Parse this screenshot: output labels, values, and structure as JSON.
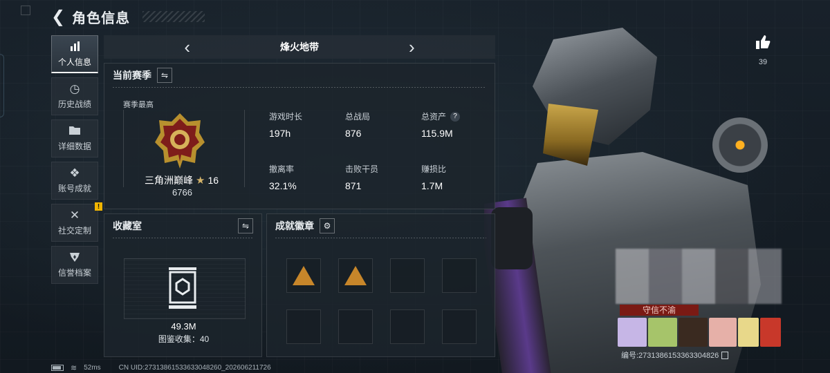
{
  "header": {
    "title": "角色信息",
    "back_icon": "back-arrow-icon"
  },
  "sidebar": {
    "items": [
      {
        "label": "个人信息",
        "icon": "bar-chart-icon",
        "active": true
      },
      {
        "label": "历史战绩",
        "icon": "clock-icon",
        "active": false
      },
      {
        "label": "详细数据",
        "icon": "folder-icon",
        "active": false
      },
      {
        "label": "账号成就",
        "icon": "diamond-icon",
        "active": false
      },
      {
        "label": "社交定制",
        "icon": "tools-icon",
        "active": false,
        "badge": "!"
      },
      {
        "label": "信誉档案",
        "icon": "shield-icon",
        "active": false
      }
    ]
  },
  "mode": {
    "name": "烽火地带"
  },
  "season": {
    "title": "当前赛季",
    "subtitle": "赛季最高",
    "rank": {
      "name": "三角洲巅峰",
      "star": "★",
      "stars": "16",
      "score": "6766"
    },
    "stats": [
      {
        "label": "游戏时长",
        "value": "197h"
      },
      {
        "label": "总战局",
        "value": "876"
      },
      {
        "label": "总资产",
        "value": "115.9M",
        "help": "?"
      },
      {
        "label": "撤离率",
        "value": "32.1%"
      },
      {
        "label": "击败干员",
        "value": "871"
      },
      {
        "label": "赚损比",
        "value": "1.7M"
      }
    ]
  },
  "collection": {
    "title": "收藏室",
    "value": "49.3M",
    "count_text": "图鉴收集：40"
  },
  "achievements": {
    "title": "成就徽章",
    "filled_slots": 2,
    "total_slots": 8
  },
  "likes": {
    "count": "39"
  },
  "player": {
    "motto": "守信不渝",
    "id_text": "编号:2731386153363304826"
  },
  "statusbar": {
    "ping": "52ms",
    "uid": "CN UID:27313861533633048260_202606211726"
  },
  "colors": {
    "accent_gold": "#c7862a",
    "motto_red": "#7a1a14",
    "panel_bg": "#1c242c"
  }
}
